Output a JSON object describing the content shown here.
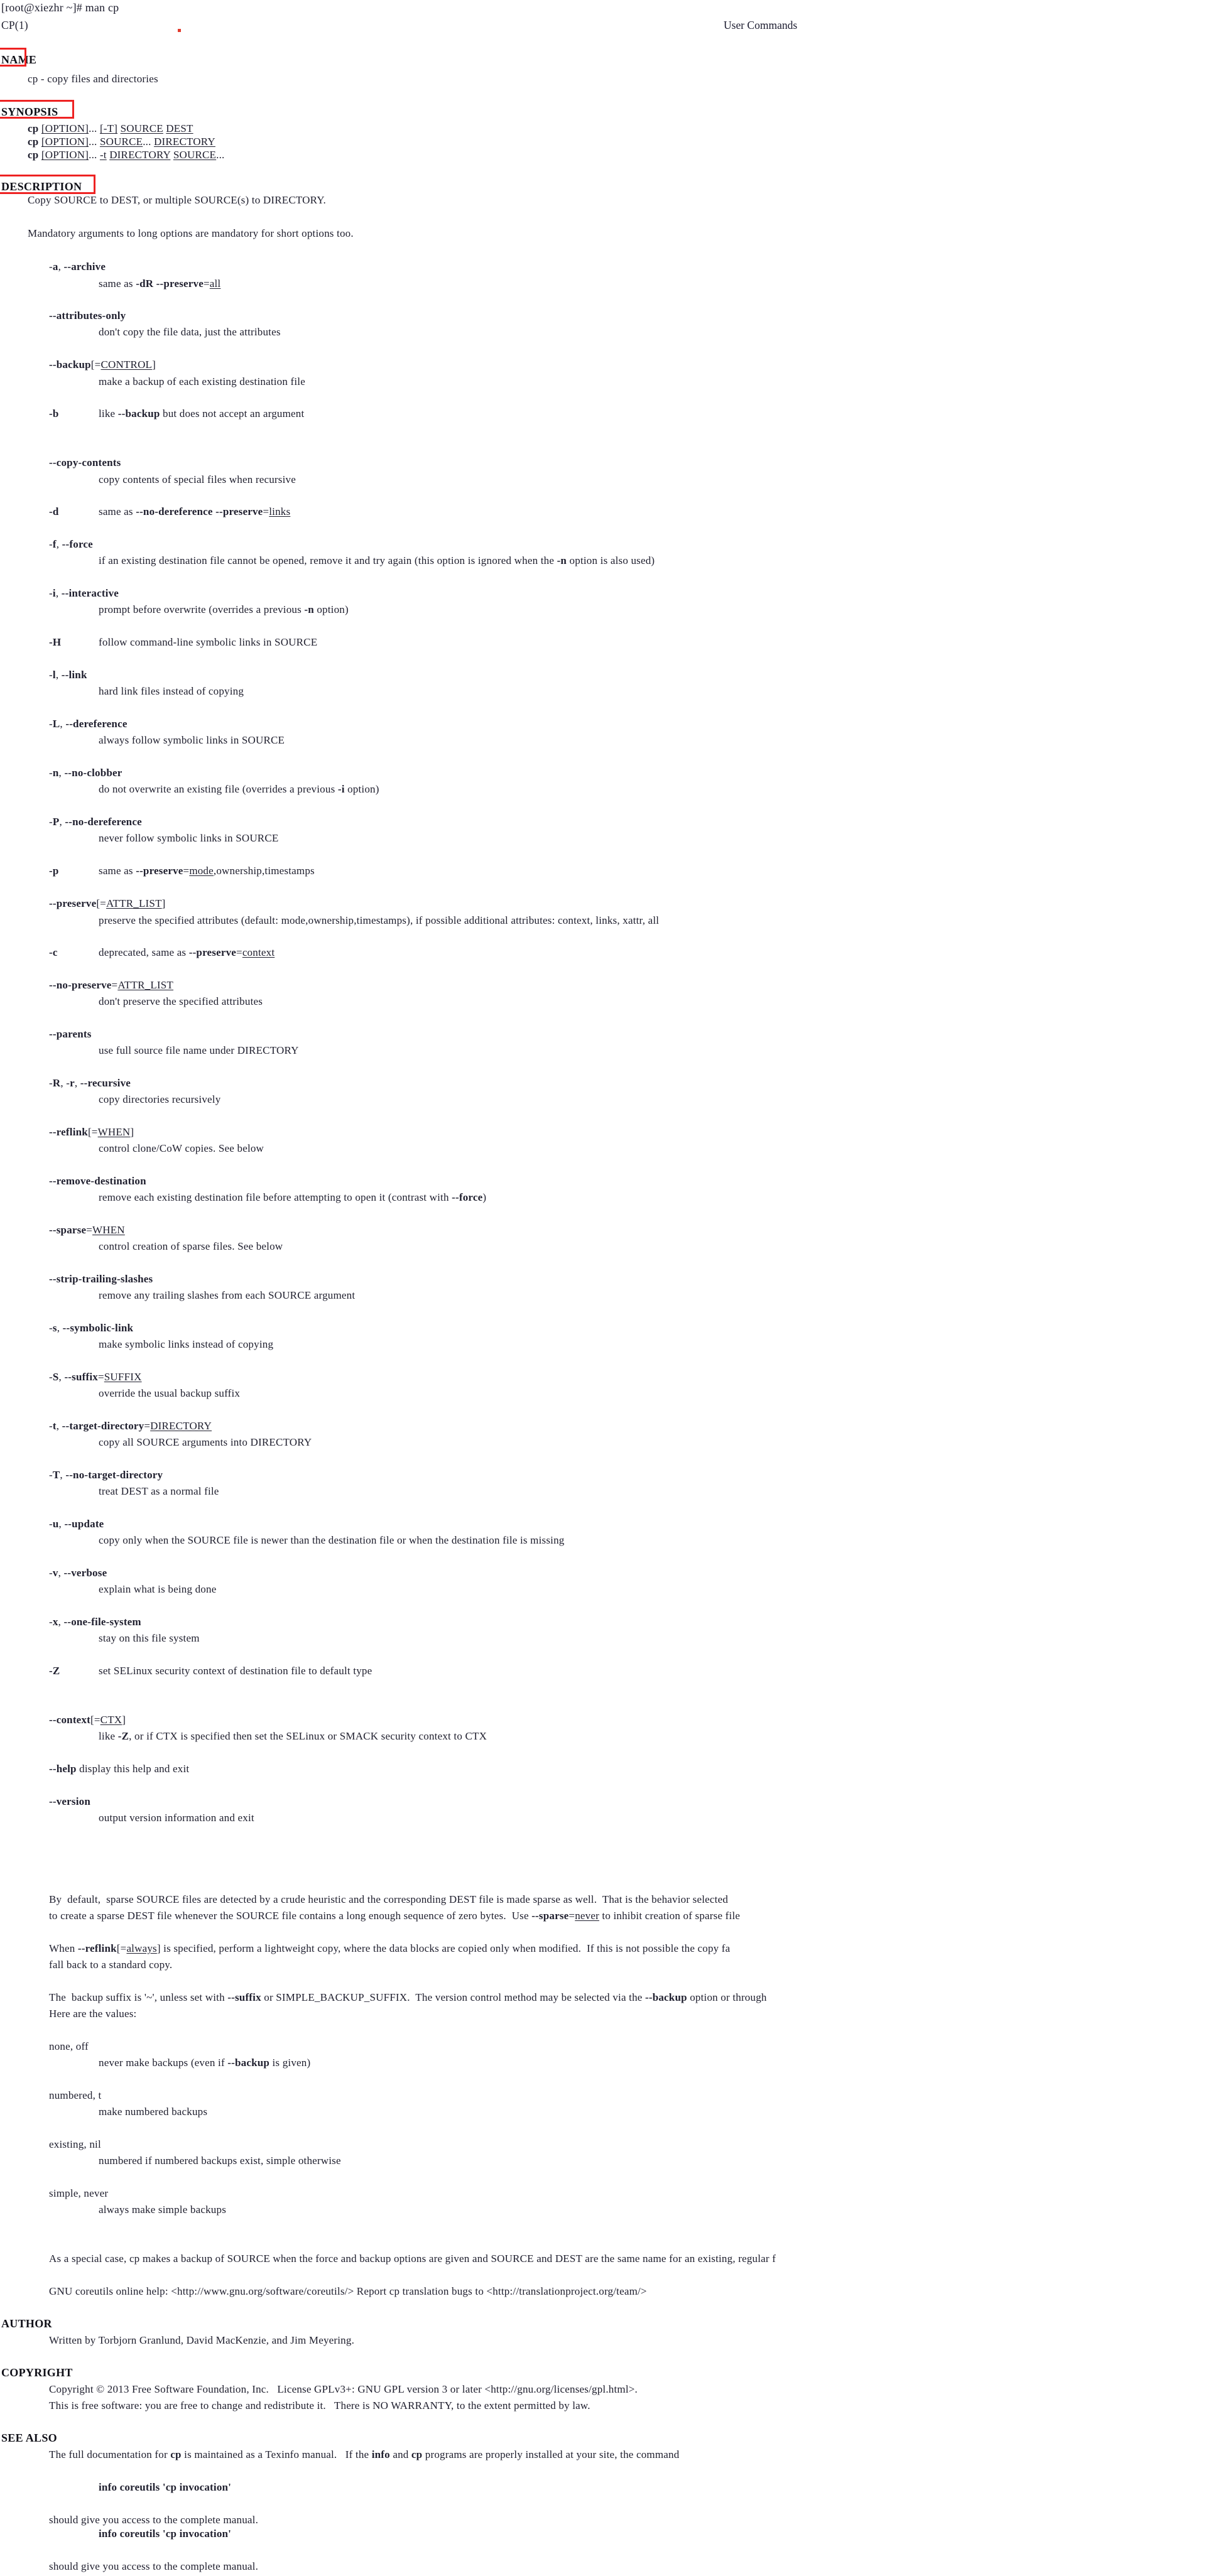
{
  "terminal": {
    "prompt_line": "[root@xiezhr ~]# man cp"
  },
  "manpage": {
    "header_left": "CP(1)",
    "header_center": "User Commands",
    "sections": {
      "name": "NAME",
      "synopsis": "SYNOPSIS",
      "description": "DESCRIPTION",
      "author": "AUTHOR",
      "copyright": "COPYRIGHT",
      "see_also": "SEE ALSO"
    },
    "name_body": "cp - copy files and directories",
    "synopsis_lines": [
      "cp [OPTION]... [-T] SOURCE DEST",
      "cp [OPTION]... SOURCE... DIRECTORY",
      "cp [OPTION]... -t DIRECTORY SOURCE..."
    ],
    "description_intro": [
      "Copy SOURCE to DEST, or multiple SOURCE(s) to DIRECTORY.",
      "Mandatory arguments to long options are mandatory for short options too."
    ],
    "options": [
      {
        "flag": "-a, --archive",
        "desc": "same as -dR --preserve=all"
      },
      {
        "flag": "--attributes-only",
        "desc": "don't copy the file data, just the attributes"
      },
      {
        "flag": "--backup[=CONTROL]",
        "desc": "make a backup of each existing destination file"
      },
      {
        "flag": "-b",
        "desc": "like --backup but does not accept an argument",
        "inline": true
      },
      {
        "flag": "--copy-contents",
        "desc": "copy contents of special files when recursive"
      },
      {
        "flag": "-d",
        "desc": "same as --no-dereference --preserve=links",
        "inline": true
      },
      {
        "flag": "-f, --force",
        "desc": "if an existing destination file cannot be opened, remove it and try again (this option is ignored when the -n option is also used)"
      },
      {
        "flag": "-i, --interactive",
        "desc": "prompt before overwrite (overrides a previous -n option)"
      },
      {
        "flag": "-H",
        "desc": "follow command-line symbolic links in SOURCE",
        "inline": true
      },
      {
        "flag": "-l, --link",
        "desc": "hard link files instead of copying"
      },
      {
        "flag": "-L, --dereference",
        "desc": "always follow symbolic links in SOURCE"
      },
      {
        "flag": "-n, --no-clobber",
        "desc": "do not overwrite an existing file (overrides a previous -i option)"
      },
      {
        "flag": "-P, --no-dereference",
        "desc": "never follow symbolic links in SOURCE"
      },
      {
        "flag": "-p",
        "desc": "same as --preserve=mode,ownership,timestamps",
        "inline": true
      },
      {
        "flag": "--preserve[=ATTR_LIST]",
        "desc": "preserve the specified attributes (default: mode,ownership,timestamps), if possible additional attributes: context, links, xattr, all"
      },
      {
        "flag": "-c",
        "desc": "deprecated, same as --preserve=context",
        "inline": true
      },
      {
        "flag": "--no-preserve=ATTR_LIST",
        "desc": "don't preserve the specified attributes"
      },
      {
        "flag": "--parents",
        "desc": "use full source file name under DIRECTORY"
      },
      {
        "flag": "-R, -r, --recursive",
        "desc": "copy directories recursively"
      },
      {
        "flag": "--reflink[=WHEN]",
        "desc": "control clone/CoW copies. See below"
      },
      {
        "flag": "--remove-destination",
        "desc": "remove each existing destination file before attempting to open it (contrast with --force)"
      },
      {
        "flag": "--sparse=WHEN",
        "desc": "control creation of sparse files. See below"
      },
      {
        "flag": "--strip-trailing-slashes",
        "desc": "remove any trailing slashes from each SOURCE argument"
      },
      {
        "flag": "-s, --symbolic-link",
        "desc": "make symbolic links instead of copying"
      },
      {
        "flag": "-S, --suffix=SUFFIX",
        "desc": "override the usual backup suffix"
      },
      {
        "flag": "-t, --target-directory=DIRECTORY",
        "desc": "copy all SOURCE arguments into DIRECTORY"
      },
      {
        "flag": "-T, --no-target-directory",
        "desc": "treat DEST as a normal file"
      },
      {
        "flag": "-u, --update",
        "desc": "copy only when the SOURCE file is newer than the destination file or when the destination file is missing"
      },
      {
        "flag": "-v, --verbose",
        "desc": "explain what is being done"
      },
      {
        "flag": "-x, --one-file-system",
        "desc": "stay on this file system"
      },
      {
        "flag": "-Z",
        "desc": "set SELinux security context of destination file to default type",
        "inline": true
      },
      {
        "flag": "--context[=CTX]",
        "desc": "like -Z, or if CTX is specified then set the SELinux or SMACK security context to CTX"
      },
      {
        "flag": "--help",
        "desc": "display this help and exit",
        "inline": true
      },
      {
        "flag": "--version",
        "desc": "output version information and exit"
      }
    ],
    "sparse_paragraph": [
      "By  default,  sparse SOURCE files are detected by a crude heuristic and the corresponding DEST file is made sparse as well.  That is the behavior selected",
      "to create a sparse DEST file whenever the SOURCE file contains a long enough sequence of zero bytes.  Use --sparse=never to inhibit creation of sparse file"
    ],
    "reflink_paragraph": [
      "When --reflink[=always] is specified, perform a lightweight copy, where the data blocks are copied only when modified.  If this is not possible the copy fa",
      "fall back to a standard copy."
    ],
    "suffix_paragraph": [
      "The  backup suffix is '~', unless set with --suffix or SIMPLE_BACKUP_SUFFIX.  The version control method may be selected via the --backup option or through",
      "Here are the values:"
    ],
    "backup_values": [
      {
        "name": "none, off",
        "desc": "never make backups (even if --backup is given)"
      },
      {
        "name": "numbered, t",
        "desc": "make numbered backups"
      },
      {
        "name": "existing, nil",
        "desc": "numbered if numbered backups exist, simple otherwise"
      },
      {
        "name": "simple, never",
        "desc": "always make simple backups"
      }
    ],
    "special_case": "As a special case, cp makes a backup of SOURCE when the force and backup options are given and SOURCE and DEST are the same name for an existing, regular f",
    "online_help": "GNU coreutils online help: <http://www.gnu.org/software/coreutils/> Report cp translation bugs to <http://translationproject.org/team/>",
    "author_body": "Written by Torbjorn Granlund, David MacKenzie, and Jim Meyering.",
    "copyright_body": [
      "Copyright © 2013 Free Software Foundation, Inc.   License GPLv3+: GNU GPL version 3 or later <http://gnu.org/licenses/gpl.html>.",
      "This is free software: you are free to change and redistribute it.   There is NO WARRANTY, to the extent permitted by law."
    ],
    "see_also_body": {
      "line1": "The full documentation for cp is maintained as a Texinfo manual.   If the info and cp programs are properly installed at your site, the command",
      "command": "info coreutils 'cp invocation'",
      "line2": "should give you access to the complete manual.",
      "command2": "info coreutils 'cp invocation'",
      "line3": "should give you access to the complete manual."
    }
  },
  "annotations": {
    "accent_color": "#ee2222",
    "dot_color": "#e23b2e",
    "boxes": [
      "NAME",
      "SYNOPSIS",
      "DESCRIPTION"
    ]
  }
}
